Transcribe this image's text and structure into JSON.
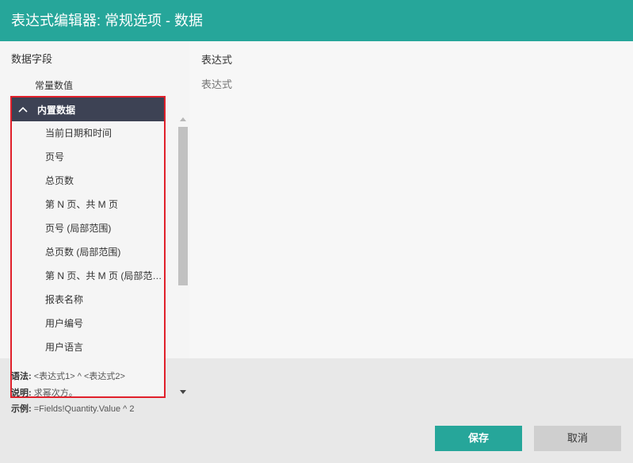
{
  "title": "表达式编辑器: 常规选项 - 数据",
  "left": {
    "title": "数据字段",
    "constant_item": "常量数值",
    "group": {
      "label": "内置数据",
      "items": [
        "当前日期和时间",
        "页号",
        "总页数",
        "第 N 页、共 M 页",
        "页号 (局部范围)",
        "总页数 (局部范围)",
        "第 N 页、共 M 页 (局部范围)",
        "报表名称",
        "用户编号",
        "用户语言"
      ]
    }
  },
  "right": {
    "label": "表达式",
    "placeholder": "表达式"
  },
  "info": {
    "syntax_label": "语法:",
    "syntax": "<表达式1> ^ <表达式2>",
    "desc_label": "说明:",
    "desc": "求幂次方。",
    "example_label": "示例:",
    "example": "=Fields!Quantity.Value ^ 2"
  },
  "buttons": {
    "save": "保存",
    "cancel": "取消"
  },
  "icons": {
    "group_toggle": "chevron-up-icon",
    "scroll_up": "scroll-up-arrow-icon",
    "scroll_down": "scroll-down-arrow-icon"
  },
  "colors": {
    "accent": "#26a69a",
    "group_header": "#3d4254",
    "highlight_border": "#e0202a"
  }
}
